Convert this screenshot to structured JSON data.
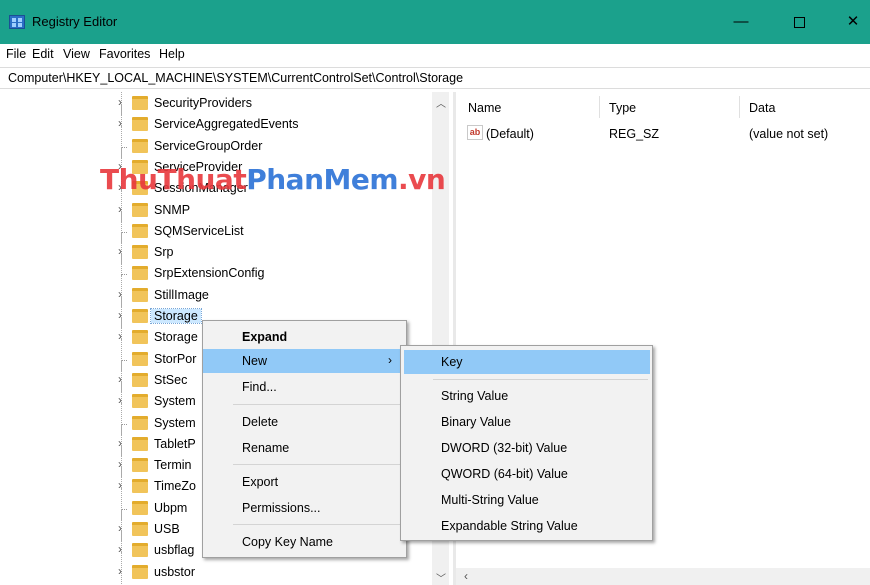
{
  "window": {
    "title": "Registry Editor",
    "controls": {
      "minimize": "—",
      "close": "✕"
    }
  },
  "menu": [
    "File",
    "Edit",
    "View",
    "Favorites",
    "Help"
  ],
  "address": "Computer\\HKEY_LOCAL_MACHINE\\SYSTEM\\CurrentControlSet\\Control\\Storage",
  "tree": {
    "items": [
      {
        "label": "SecurityProviders",
        "expandable": true
      },
      {
        "label": "ServiceAggregatedEvents",
        "expandable": true
      },
      {
        "label": "ServiceGroupOrder",
        "expandable": false
      },
      {
        "label": "ServiceProvider",
        "expandable": true
      },
      {
        "label": "SessionManager",
        "expandable": true
      },
      {
        "label": "SNMP",
        "expandable": true
      },
      {
        "label": "SQMServiceList",
        "expandable": false
      },
      {
        "label": "Srp",
        "expandable": true
      },
      {
        "label": "SrpExtensionConfig",
        "expandable": false
      },
      {
        "label": "StillImage",
        "expandable": true
      },
      {
        "label": "Storage",
        "expandable": true,
        "selected": true
      },
      {
        "label": "Storage",
        "expandable": true
      },
      {
        "label": "StorPor",
        "expandable": false
      },
      {
        "label": "StSec",
        "expandable": true
      },
      {
        "label": "System",
        "expandable": true
      },
      {
        "label": "System",
        "expandable": false
      },
      {
        "label": "TabletP",
        "expandable": true
      },
      {
        "label": "Termin",
        "expandable": true
      },
      {
        "label": "TimeZo",
        "expandable": true
      },
      {
        "label": "Ubpm",
        "expandable": false
      },
      {
        "label": "USB",
        "expandable": true
      },
      {
        "label": "usbflag",
        "expandable": true
      },
      {
        "label": "usbstor",
        "expandable": true
      }
    ]
  },
  "values_pane": {
    "columns": [
      "Name",
      "Type",
      "Data"
    ],
    "rows": [
      {
        "icon": "ab",
        "name": "(Default)",
        "type": "REG_SZ",
        "data": "(value not set)"
      }
    ]
  },
  "watermark": {
    "part1": "ThuThuat",
    "part2": "PhanMem",
    "part3": ".vn"
  },
  "context_menu": {
    "items": [
      {
        "label": "Expand",
        "bold": true
      },
      {
        "label": "New",
        "highlighted": true,
        "submenu_arrow": "›"
      },
      {
        "label": "Find..."
      },
      {
        "label": "Delete"
      },
      {
        "label": "Rename"
      },
      {
        "label": "Export"
      },
      {
        "label": "Permissions..."
      },
      {
        "label": "Copy Key Name"
      }
    ]
  },
  "new_submenu": {
    "items": [
      {
        "label": "Key",
        "highlighted": true
      },
      {
        "label": "String Value"
      },
      {
        "label": "Binary Value"
      },
      {
        "label": "DWORD (32-bit) Value"
      },
      {
        "label": "QWORD (64-bit) Value"
      },
      {
        "label": "Multi-String Value"
      },
      {
        "label": "Expandable String Value"
      }
    ]
  },
  "colors": {
    "titlebar": "#1ba18c",
    "menu_highlight": "#91c9f7",
    "selection": "#cce8ff"
  }
}
